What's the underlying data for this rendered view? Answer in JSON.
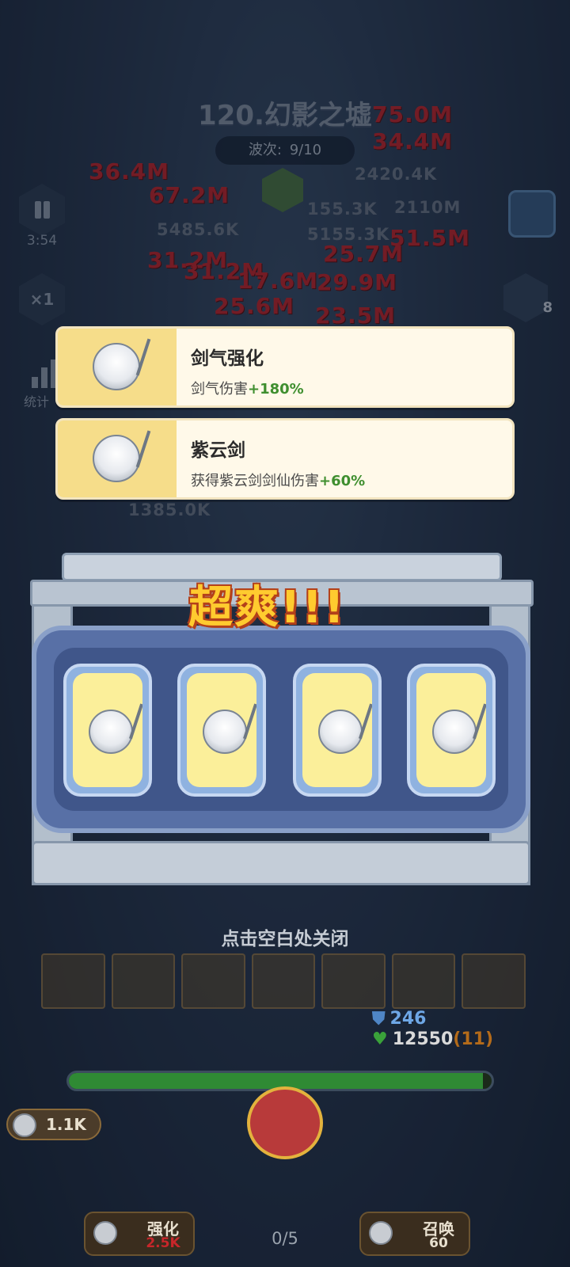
{
  "hud": {
    "level_title": "120.幻影之墟",
    "wave_label": "波次:",
    "wave_value": "9/10",
    "timer": "3:54",
    "speed": "×1",
    "stats_label": "统计",
    "right_count": "8"
  },
  "damage_numbers": {
    "red": [
      "75.0M",
      "34.4M",
      "36.4M",
      "67.2M",
      "51.5M",
      "31.2M",
      "31.2M",
      "25.7M",
      "17.6M",
      "29.9M",
      "25.6M",
      "23.5M"
    ],
    "grey": [
      "2420.4K",
      "155.3K",
      "2110M",
      "5485.6K",
      "5155.3K",
      "1385.0K"
    ]
  },
  "cards": [
    {
      "title": "剑气强化",
      "desc": "剑气伤害",
      "bonus": "+180%"
    },
    {
      "title": "紫云剑",
      "desc": "获得紫云剑剑仙伤害",
      "bonus": "+60%"
    }
  ],
  "jackpot_text": "超爽!!!",
  "close_hint": "点击空白处关闭",
  "base": {
    "shield": "246",
    "hp": "12550",
    "hp_extra": "(11)",
    "hp_fill": 0.98,
    "coins": "1.1K",
    "progress": "0/5"
  },
  "actions": {
    "upgrade_label": "强化",
    "upgrade_cost": "2.5K",
    "summon_label": "召唤",
    "summon_cost": "60"
  },
  "colors": {
    "upgrade_cost": "#c8262a",
    "summon_cost": "#e8e0cf"
  }
}
